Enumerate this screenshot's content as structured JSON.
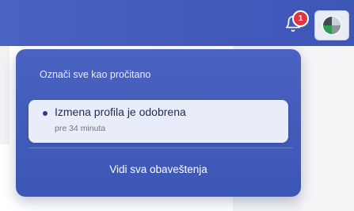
{
  "header": {
    "notifications_badge_count": "1",
    "bell_icon": "bell-icon",
    "avatar": "user-avatar"
  },
  "dropdown": {
    "mark_all_read_label": "Označi sve kao pročitano",
    "items": [
      {
        "title": "Izmena profila je odobrena",
        "time": "pre 34 minuta",
        "unread": true
      }
    ],
    "see_all_label": "Vidi sva obaveštenja"
  },
  "colors": {
    "brand_blue": "#4560c0",
    "badge_red": "#e0353f",
    "item_background": "#e8edf9"
  }
}
